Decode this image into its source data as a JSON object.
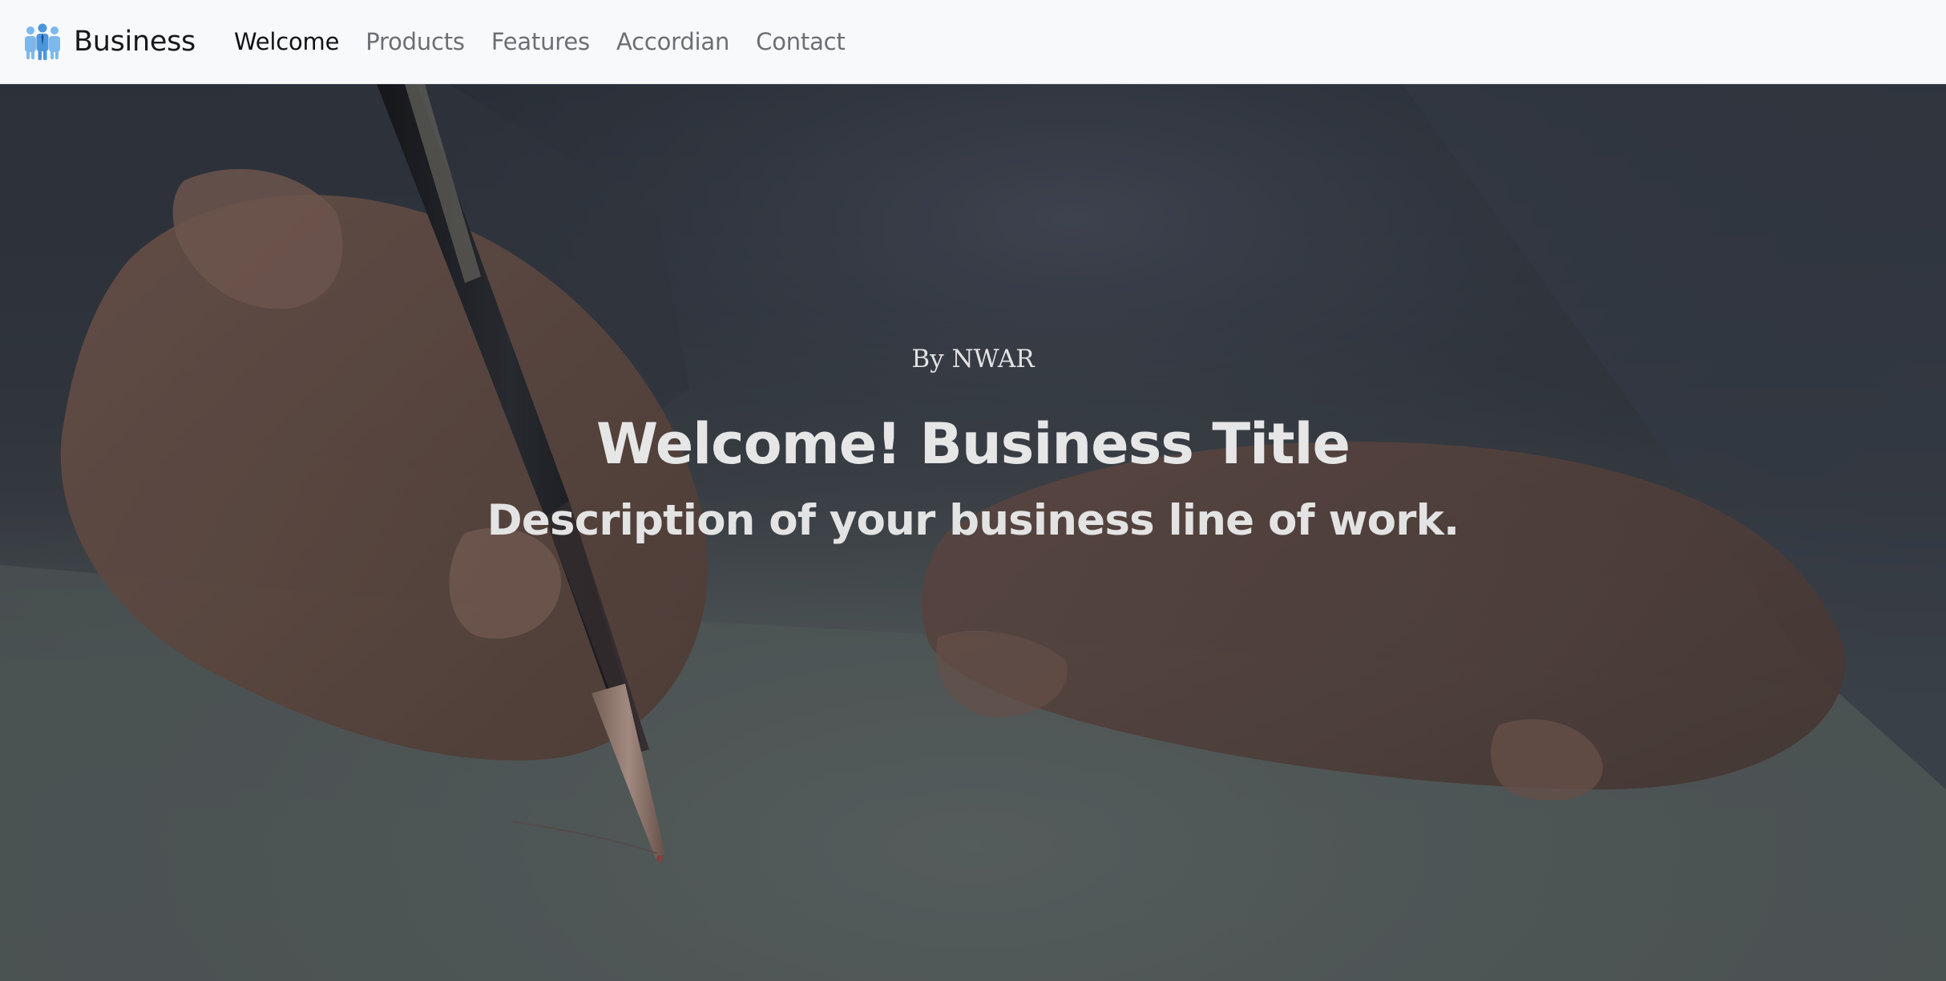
{
  "navbar": {
    "brand_text": "Business",
    "brand_icon": "people-icon",
    "links": [
      {
        "label": "Welcome",
        "active": true
      },
      {
        "label": "Products",
        "active": false
      },
      {
        "label": "Features",
        "active": false
      },
      {
        "label": "Accordian",
        "active": false
      },
      {
        "label": "Contact",
        "active": false
      }
    ]
  },
  "hero": {
    "byline": "By NWAR",
    "title": "Welcome! Business Title",
    "subtitle": "Description of your business line of work."
  },
  "colors": {
    "navbar_bg": "#f8f9fb",
    "brand_blue": "#6fb0e8",
    "brand_dark_blue": "#2f6fb6",
    "hero_text": "#e6e6e6"
  }
}
